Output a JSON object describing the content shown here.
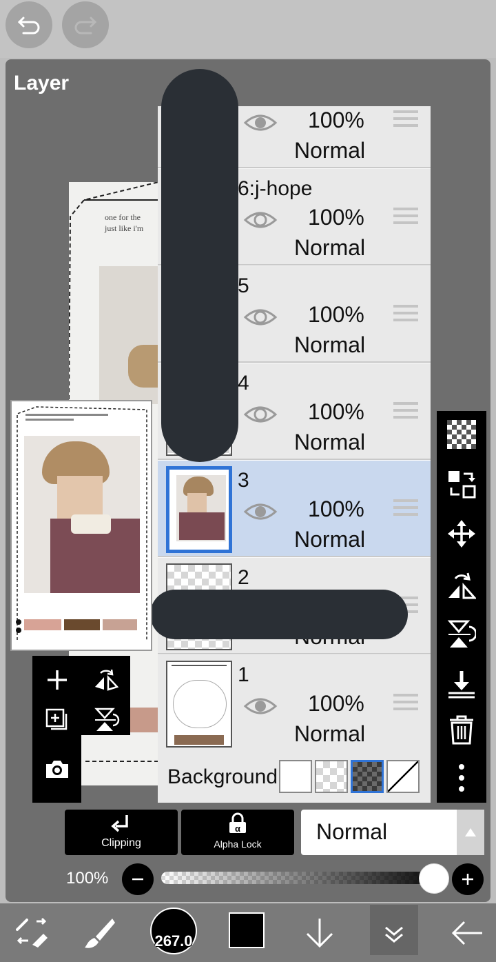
{
  "panel": {
    "title": "Layer"
  },
  "canvas_text": [
    "one for the",
    "just like i'm"
  ],
  "layers": [
    {
      "name": "",
      "opacity": "100%",
      "blend": "Normal"
    },
    {
      "name": "6:j-hope",
      "opacity": "100%",
      "blend": "Normal"
    },
    {
      "name": "5",
      "opacity": "100%",
      "blend": "Normal"
    },
    {
      "name": "4",
      "opacity": "100%",
      "blend": "Normal"
    },
    {
      "name": "3",
      "opacity": "100%",
      "blend": "Normal",
      "selected": true
    },
    {
      "name": "2",
      "opacity": "",
      "blend": "Normal"
    },
    {
      "name": "1",
      "opacity": "100%",
      "blend": "Normal"
    }
  ],
  "background": {
    "label": "Background"
  },
  "controls": {
    "clipping": "Clipping",
    "alpha_lock": "Alpha Lock",
    "blend_mode": "Normal",
    "opacity_label": "100%",
    "opacity_value": 1.0
  },
  "toolbar": {
    "brush_size": "267.0"
  },
  "colors": {
    "panel": "#6e6e6e",
    "selected_layer": "#c9d8ee",
    "selection_border": "#2f73d6",
    "foreground_color": "#000000"
  }
}
